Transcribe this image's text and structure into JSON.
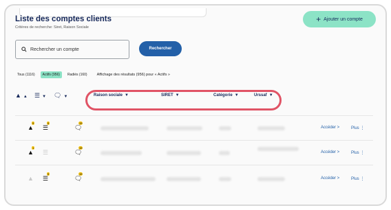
{
  "page": {
    "title": "Liste des comptes clients",
    "subtitle": "Critères de recherche: Siret, Raison Sociale",
    "add_button": "Ajouter un compte",
    "add_icon": "+"
  },
  "search": {
    "placeholder": "Rechercher un compte",
    "button": "Rechercher"
  },
  "filters": {
    "all": "Tous (1116)",
    "active": "Actifs (956)",
    "removed": "Radiés (160)",
    "display_info": "Affichage des résultats (956) pour « Actifs »"
  },
  "columns": {
    "raison_sociale": "Raison sociale",
    "siret": "SIRET",
    "categorie": "Catégorie",
    "urssaf": "Urssaf"
  },
  "rows": [
    {
      "alert_badge": "9",
      "list_badge": "5",
      "chat_badge": "15",
      "access": "Accéder",
      "more": "Plus"
    },
    {
      "alert_badge": "1",
      "list_badge": "",
      "chat_badge": "15",
      "access": "Accéder",
      "more": "Plus"
    },
    {
      "alert_badge": "",
      "list_badge": "5",
      "chat_badge": "15",
      "access": "Accéder",
      "more": "Plus"
    }
  ],
  "colors": {
    "accent": "#2360a8",
    "brand_green": "#8ce3c6",
    "highlight": "#e05365",
    "navy": "#16285a"
  }
}
